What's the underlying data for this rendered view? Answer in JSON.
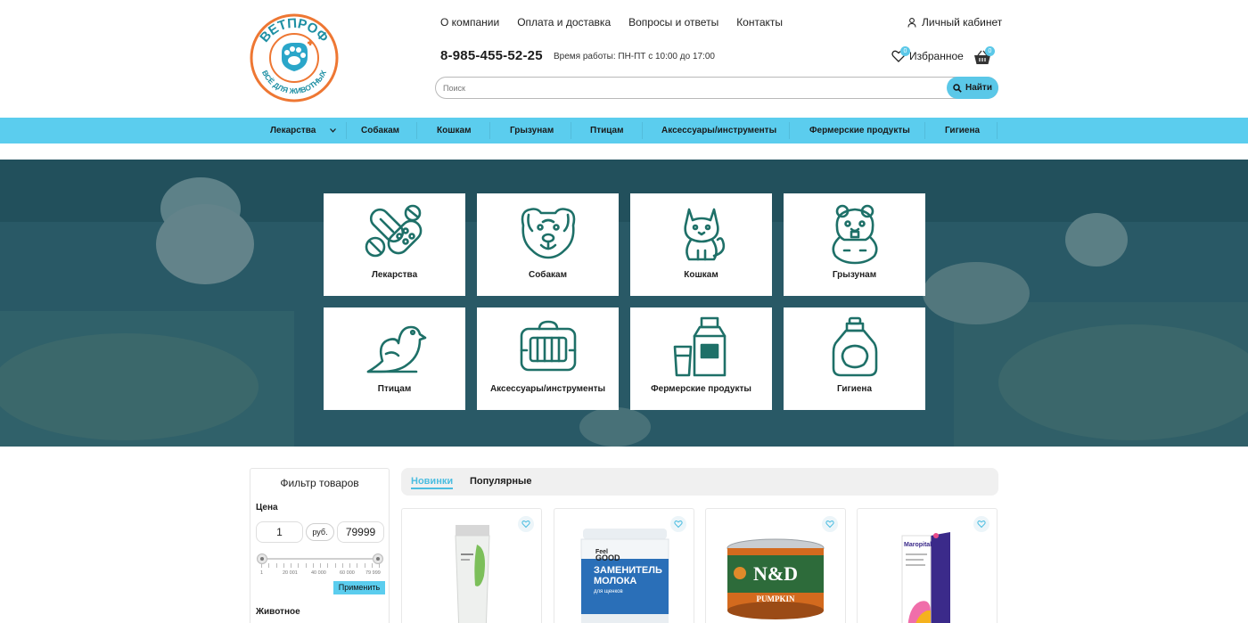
{
  "header": {
    "brand_logo_text_top": "ВЕТПРОФ",
    "brand_logo_text_bottom": "ВСЁ ДЛЯ ЖИВОТНЫХ",
    "top_nav": [
      "О компании",
      "Оплата и доставка",
      "Вопросы и ответы",
      "Контакты"
    ],
    "account_label": "Личный кабинет",
    "phone": "8-985-455-52-25",
    "work_hours": "Время работы: ПН-ПТ с 10:00 до 17:00",
    "favorites_label": "Избранное",
    "favorites_count": "0",
    "cart_count": "0",
    "search_placeholder": "Поиск",
    "search_button": "Найти"
  },
  "category_bar": [
    "Лекарства",
    "Собакам",
    "Кошкам",
    "Грызунам",
    "Птицам",
    "Аксессуары/инструменты",
    "Фермерские продукты",
    "Гигиена"
  ],
  "category_tiles": [
    {
      "label": "Лекарства",
      "icon": "pills-icon"
    },
    {
      "label": "Собакам",
      "icon": "dog-icon"
    },
    {
      "label": "Кошкам",
      "icon": "cat-icon"
    },
    {
      "label": "Грызунам",
      "icon": "hamster-icon"
    },
    {
      "label": "Птицам",
      "icon": "bird-icon"
    },
    {
      "label": "Аксессуары/инструменты",
      "icon": "pet-carrier-icon"
    },
    {
      "label": "Фермерские продукты",
      "icon": "milk-icon"
    },
    {
      "label": "Гигиена",
      "icon": "soap-bottle-icon"
    }
  ],
  "filter": {
    "title": "Фильтр товаров",
    "price_label": "Цена",
    "price_min": "1",
    "currency": "руб.",
    "price_max": "79999",
    "scale_labels": [
      "1",
      "20 001",
      "40 000",
      "60 000",
      "79 999"
    ],
    "apply_button": "Применить",
    "animal_label": "Животное"
  },
  "product_tabs": [
    "Новинки",
    "Популярные"
  ],
  "product_cards": [
    {
      "image": "tube-product"
    },
    {
      "image": "jar-product",
      "label_lines": [
        "Feel",
        "GOOD",
        "ЗАМЕНИТЕЛЬ",
        "МОЛОКА",
        "для щенков"
      ]
    },
    {
      "image": "can-product",
      "label_lines": [
        "N&D",
        "PUMPKIN"
      ]
    },
    {
      "image": "box-product",
      "label_lines": [
        "Maropital"
      ]
    }
  ],
  "colors": {
    "accent": "#5bcdee",
    "logo_teal": "#1e8fa3",
    "logo_orange": "#ee7733",
    "hero_overlay": "#2d5d6b",
    "icon_teal": "#1e7068"
  }
}
